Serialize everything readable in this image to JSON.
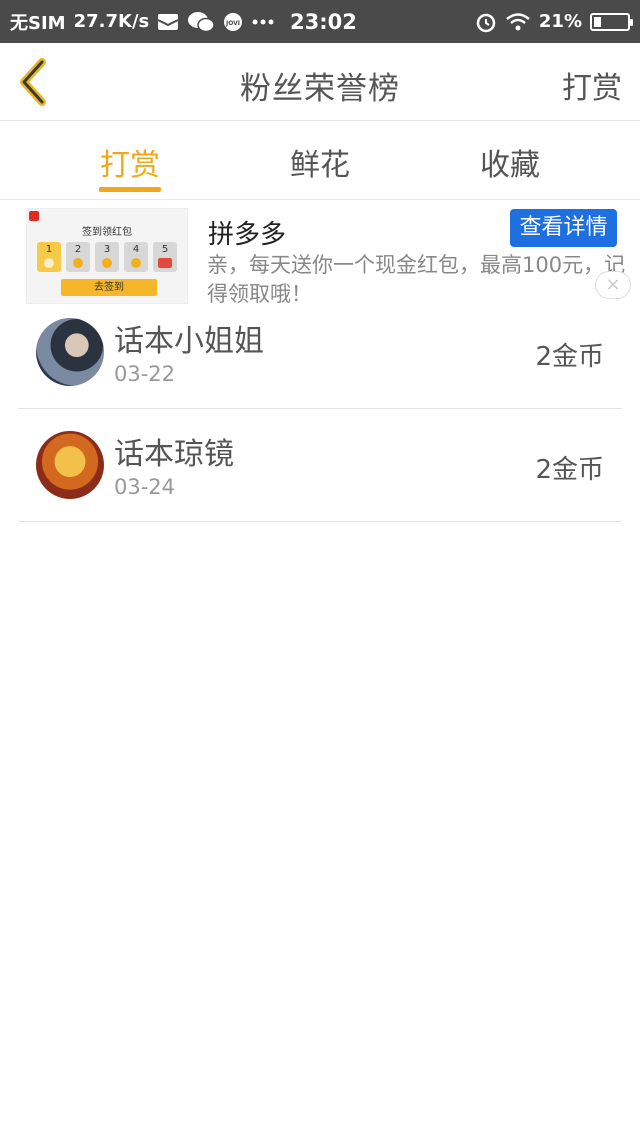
{
  "status_bar": {
    "carrier": "无SIM",
    "speed": "27.7K/s",
    "time": "23:02",
    "battery": "21%",
    "battery_level": 0.21,
    "icons": [
      "vivo-mail-icon",
      "wechat-icon",
      "jovi-icon",
      "more-dots-icon",
      "alarm-icon",
      "wifi-icon",
      "battery-icon"
    ]
  },
  "header": {
    "title": "粉丝荣誉榜",
    "action_label": "打赏"
  },
  "tabs": [
    {
      "label": "打赏",
      "active": true
    },
    {
      "label": "鲜花",
      "active": false
    },
    {
      "label": "收藏",
      "active": false
    }
  ],
  "ad": {
    "image_title": "签到领红包",
    "image_days": [
      "1",
      "2",
      "3",
      "4",
      "5"
    ],
    "image_button": "去签到",
    "title": "拼多多",
    "cta": "查看详情",
    "description": "亲，每天送你一个现金红包，最高100元，记得领取哦！",
    "close_symbol": "×"
  },
  "list": [
    {
      "name": "话本小姐姐",
      "date": "03-22",
      "amount": "2金币"
    },
    {
      "name": "话本琼镜",
      "date": "03-24",
      "amount": "2金币"
    }
  ],
  "colors": {
    "accent": "#f0a81a",
    "status_bar": "#4a4a4a",
    "cta_blue": "#1e6fe0"
  }
}
